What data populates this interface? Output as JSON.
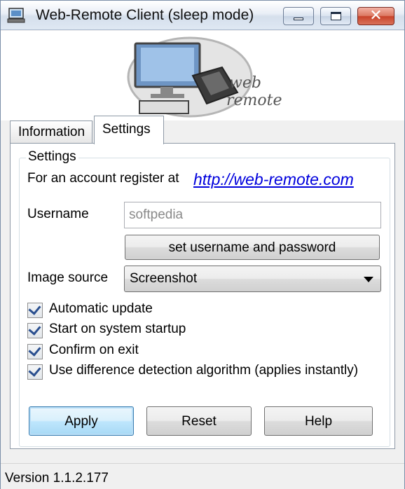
{
  "window": {
    "title": "Web-Remote Client (sleep mode)",
    "close_glyph": "✕"
  },
  "logo": {
    "line1": "web",
    "line2": "remote"
  },
  "tabs": [
    {
      "label": "Information",
      "selected": false
    },
    {
      "label": "Settings",
      "selected": true
    }
  ],
  "settings": {
    "group_title": "Settings",
    "register_text": "For an account register at",
    "register_link": "http://web-remote.com",
    "username_label": "Username",
    "username_value": "softpedia",
    "set_credentials_button": "set username and password",
    "image_source_label": "Image source",
    "image_source_value": "Screenshot",
    "checkboxes": [
      {
        "label": "Automatic update",
        "checked": true
      },
      {
        "label": "Start on system startup",
        "checked": true
      },
      {
        "label": "Confirm on exit",
        "checked": true
      },
      {
        "label": "Use difference detection algorithm (applies instantly)",
        "checked": true
      }
    ]
  },
  "buttons": {
    "apply": "Apply",
    "reset": "Reset",
    "help": "Help"
  },
  "status": {
    "version": "Version 1.1.2.177"
  },
  "colors": {
    "link": "#0000dd",
    "checkmark": "#2a4f8f",
    "close_button": "#c8432a"
  }
}
